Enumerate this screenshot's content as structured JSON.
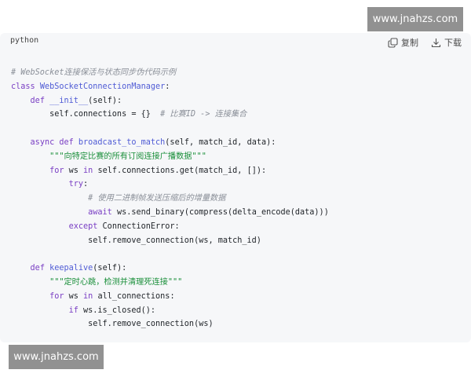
{
  "header": {
    "language": "python",
    "copy_label": "复制",
    "download_label": "下载",
    "copy_icon": "copy-icon",
    "download_icon": "download-icon"
  },
  "watermarks": {
    "top": "www.jnahzs.com",
    "bottom": "www.jnahzs.com"
  },
  "colors": {
    "card_background": "#f6f7f9",
    "comment": "#8a8f98",
    "keyword": "#7a3fc4",
    "definition": "#4f5bd5",
    "string": "#1a8f3a",
    "plain": "#1f2328",
    "watermark_background": "#8c8c8c"
  },
  "code": {
    "lines": [
      [
        {
          "t": "comment",
          "v": "# WebSocket连接保活与状态同步伪代码示例"
        }
      ],
      [
        {
          "t": "keyword",
          "v": "class "
        },
        {
          "t": "def",
          "v": "WebSocketConnectionManager"
        },
        {
          "t": "plain",
          "v": ":"
        }
      ],
      [
        {
          "t": "plain",
          "v": "    "
        },
        {
          "t": "keyword",
          "v": "def "
        },
        {
          "t": "def",
          "v": "__init__"
        },
        {
          "t": "plain",
          "v": "(self):"
        }
      ],
      [
        {
          "t": "plain",
          "v": "        self.connections = {}  "
        },
        {
          "t": "comment",
          "v": "# 比赛ID -> 连接集合"
        }
      ],
      [],
      [
        {
          "t": "plain",
          "v": "    "
        },
        {
          "t": "keyword",
          "v": "async def "
        },
        {
          "t": "def",
          "v": "broadcast_to_match"
        },
        {
          "t": "plain",
          "v": "(self, match_id, data):"
        }
      ],
      [
        {
          "t": "plain",
          "v": "        "
        },
        {
          "t": "string",
          "v": "\"\"\"向特定比赛的所有订阅连接广播数据\"\"\""
        }
      ],
      [
        {
          "t": "plain",
          "v": "        "
        },
        {
          "t": "keyword",
          "v": "for "
        },
        {
          "t": "plain",
          "v": "ws "
        },
        {
          "t": "keyword",
          "v": "in "
        },
        {
          "t": "plain",
          "v": "self.connections.get(match_id, []):"
        }
      ],
      [
        {
          "t": "plain",
          "v": "            "
        },
        {
          "t": "keyword",
          "v": "try"
        },
        {
          "t": "plain",
          "v": ":"
        }
      ],
      [
        {
          "t": "plain",
          "v": "                "
        },
        {
          "t": "comment",
          "v": "# 使用二进制帧发送压缩后的增量数据"
        }
      ],
      [
        {
          "t": "plain",
          "v": "                "
        },
        {
          "t": "keyword",
          "v": "await "
        },
        {
          "t": "plain",
          "v": "ws.send_binary(compress(delta_encode(data)))"
        }
      ],
      [
        {
          "t": "plain",
          "v": "            "
        },
        {
          "t": "keyword",
          "v": "except "
        },
        {
          "t": "plain",
          "v": "ConnectionError:"
        }
      ],
      [
        {
          "t": "plain",
          "v": "                self.remove_connection(ws, match_id)"
        }
      ],
      [],
      [
        {
          "t": "plain",
          "v": "    "
        },
        {
          "t": "keyword",
          "v": "def "
        },
        {
          "t": "def",
          "v": "keepalive"
        },
        {
          "t": "plain",
          "v": "(self):"
        }
      ],
      [
        {
          "t": "plain",
          "v": "        "
        },
        {
          "t": "string",
          "v": "\"\"\"定时心跳，检测并清理死连接\"\"\""
        }
      ],
      [
        {
          "t": "plain",
          "v": "        "
        },
        {
          "t": "keyword",
          "v": "for "
        },
        {
          "t": "plain",
          "v": "ws "
        },
        {
          "t": "keyword",
          "v": "in "
        },
        {
          "t": "plain",
          "v": "all_connections:"
        }
      ],
      [
        {
          "t": "plain",
          "v": "            "
        },
        {
          "t": "keyword",
          "v": "if "
        },
        {
          "t": "plain",
          "v": "ws.is_closed():"
        }
      ],
      [
        {
          "t": "plain",
          "v": "                self.remove_connection(ws)"
        }
      ]
    ]
  }
}
